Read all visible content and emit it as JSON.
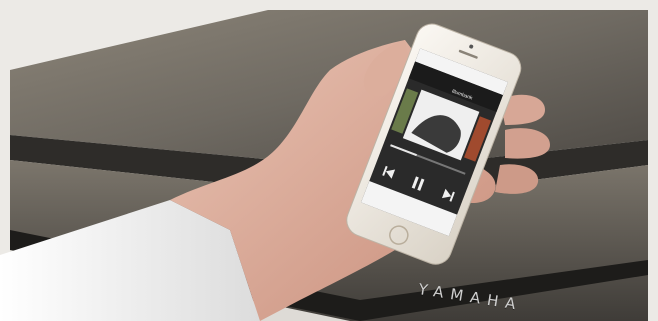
{
  "photo": {
    "subject": "hand-holding-smartphone-in-front-of-piano",
    "colors": {
      "frame": "#e9e9e6",
      "piano_wood": "#6e6a63",
      "sleeve": "#f3f3f3",
      "phone_body": "#f2eee8",
      "screen": "#2b2b2b"
    }
  },
  "piano": {
    "brand": "YAMAHA"
  },
  "phone_screen": {
    "track_title": "Illumbank",
    "header_text": "",
    "controls": [
      "previous-icon",
      "pause-icon",
      "next-icon"
    ]
  }
}
